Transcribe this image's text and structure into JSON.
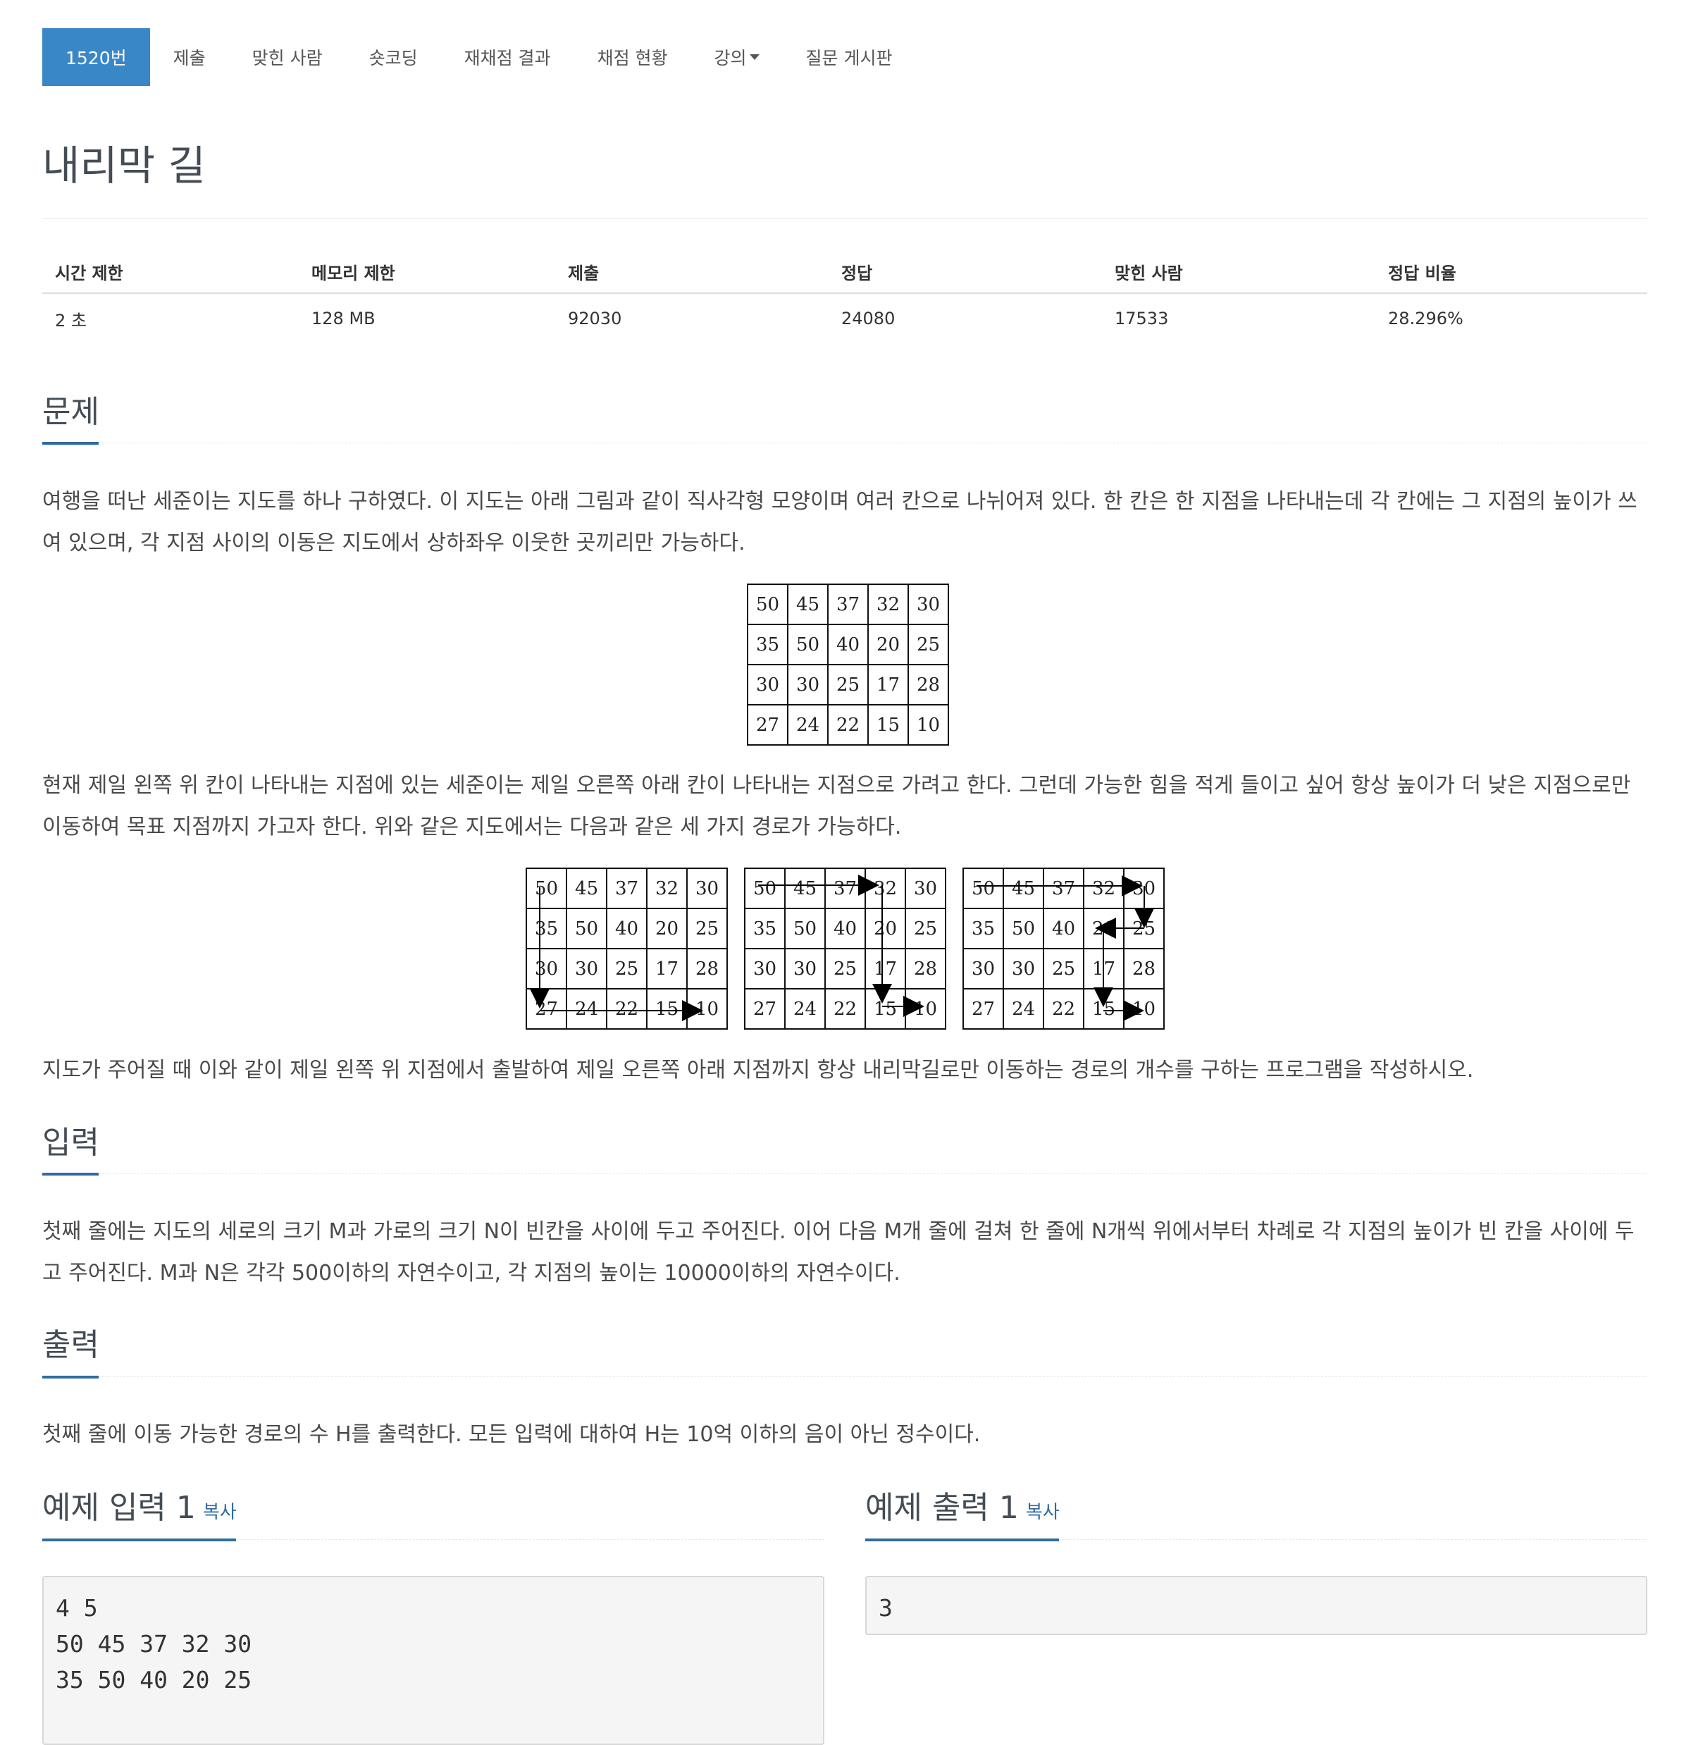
{
  "nav": {
    "tabs": [
      "1520번",
      "제출",
      "맞힌 사람",
      "숏코딩",
      "재채점 결과",
      "채점 현황",
      "강의",
      "질문 게시판"
    ]
  },
  "title": "내리막 길",
  "stats": {
    "headers": [
      "시간 제한",
      "메모리 제한",
      "제출",
      "정답",
      "맞힌 사람",
      "정답 비율"
    ],
    "values": [
      "2 초",
      "128 MB",
      "92030",
      "24080",
      "17533",
      "28.296%"
    ]
  },
  "problem": {
    "heading": "문제",
    "p1": "여행을 떠난 세준이는 지도를 하나 구하였다. 이 지도는 아래 그림과 같이 직사각형 모양이며 여러 칸으로 나뉘어져 있다. 한 칸은 한 지점을 나타내는데 각 칸에는 그 지점의 높이가 쓰여 있으며, 각 지점 사이의 이동은 지도에서 상하좌우 이웃한 곳끼리만 가능하다.",
    "p2": "현재 제일 왼쪽 위 칸이 나타내는 지점에 있는 세준이는 제일 오른쪽 아래 칸이 나타내는 지점으로 가려고 한다. 그런데 가능한 힘을 적게 들이고 싶어 항상 높이가 더 낮은 지점으로만 이동하여 목표 지점까지 가고자 한다. 위와 같은 지도에서는 다음과 같은 세 가지 경로가 가능하다.",
    "p3": "지도가 주어질 때 이와 같이 제일 왼쪽 위 지점에서 출발하여 제일 오른쪽 아래 지점까지 항상 내리막길로만 이동하는 경로의 개수를 구하는 프로그램을 작성하시오."
  },
  "grid_values": [
    [
      "50",
      "45",
      "37",
      "32",
      "30"
    ],
    [
      "35",
      "50",
      "40",
      "20",
      "25"
    ],
    [
      "30",
      "30",
      "25",
      "17",
      "28"
    ],
    [
      "27",
      "24",
      "22",
      "15",
      "10"
    ]
  ],
  "input": {
    "heading": "입력",
    "text": "첫째 줄에는 지도의 세로의 크기 M과 가로의 크기 N이 빈칸을 사이에 두고 주어진다. 이어 다음 M개 줄에 걸쳐 한 줄에 N개씩 위에서부터 차례로 각 지점의 높이가 빈 칸을 사이에 두고 주어진다. M과 N은 각각 500이하의 자연수이고, 각 지점의 높이는 10000이하의 자연수이다."
  },
  "output": {
    "heading": "출력",
    "text": "첫째 줄에 이동 가능한 경로의 수 H를 출력한다. 모든 입력에 대하여 H는 10억 이하의 음이 아닌 정수이다."
  },
  "sample_input": {
    "heading": "예제 입력 1",
    "copy": "복사",
    "content": "4 5\n50 45 37 32 30\n35 50 40 20 25"
  },
  "sample_output": {
    "heading": "예제 출력 1",
    "copy": "복사",
    "content": "3"
  }
}
